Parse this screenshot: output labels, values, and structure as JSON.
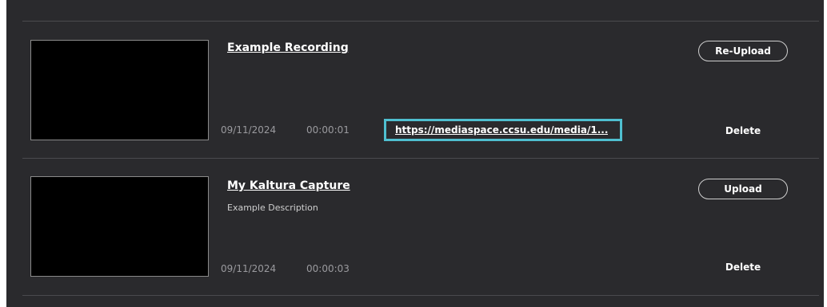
{
  "recordings": [
    {
      "title": "Example Recording",
      "description": "",
      "date": "09/11/2024",
      "duration": "00:00:01",
      "link": "https://mediaspace.ccsu.edu/media/1...",
      "action_label": "Re-Upload",
      "delete_label": "Delete"
    },
    {
      "title": "My Kaltura Capture",
      "description": "Example Description",
      "date": "09/11/2024",
      "duration": "00:00:03",
      "link": "",
      "action_label": "Upload",
      "delete_label": "Delete"
    }
  ],
  "colors": {
    "background": "#2a2a2d",
    "highlight_border": "#4fbfd0",
    "text": "#ffffff",
    "muted_text": "#9a9a9e"
  }
}
